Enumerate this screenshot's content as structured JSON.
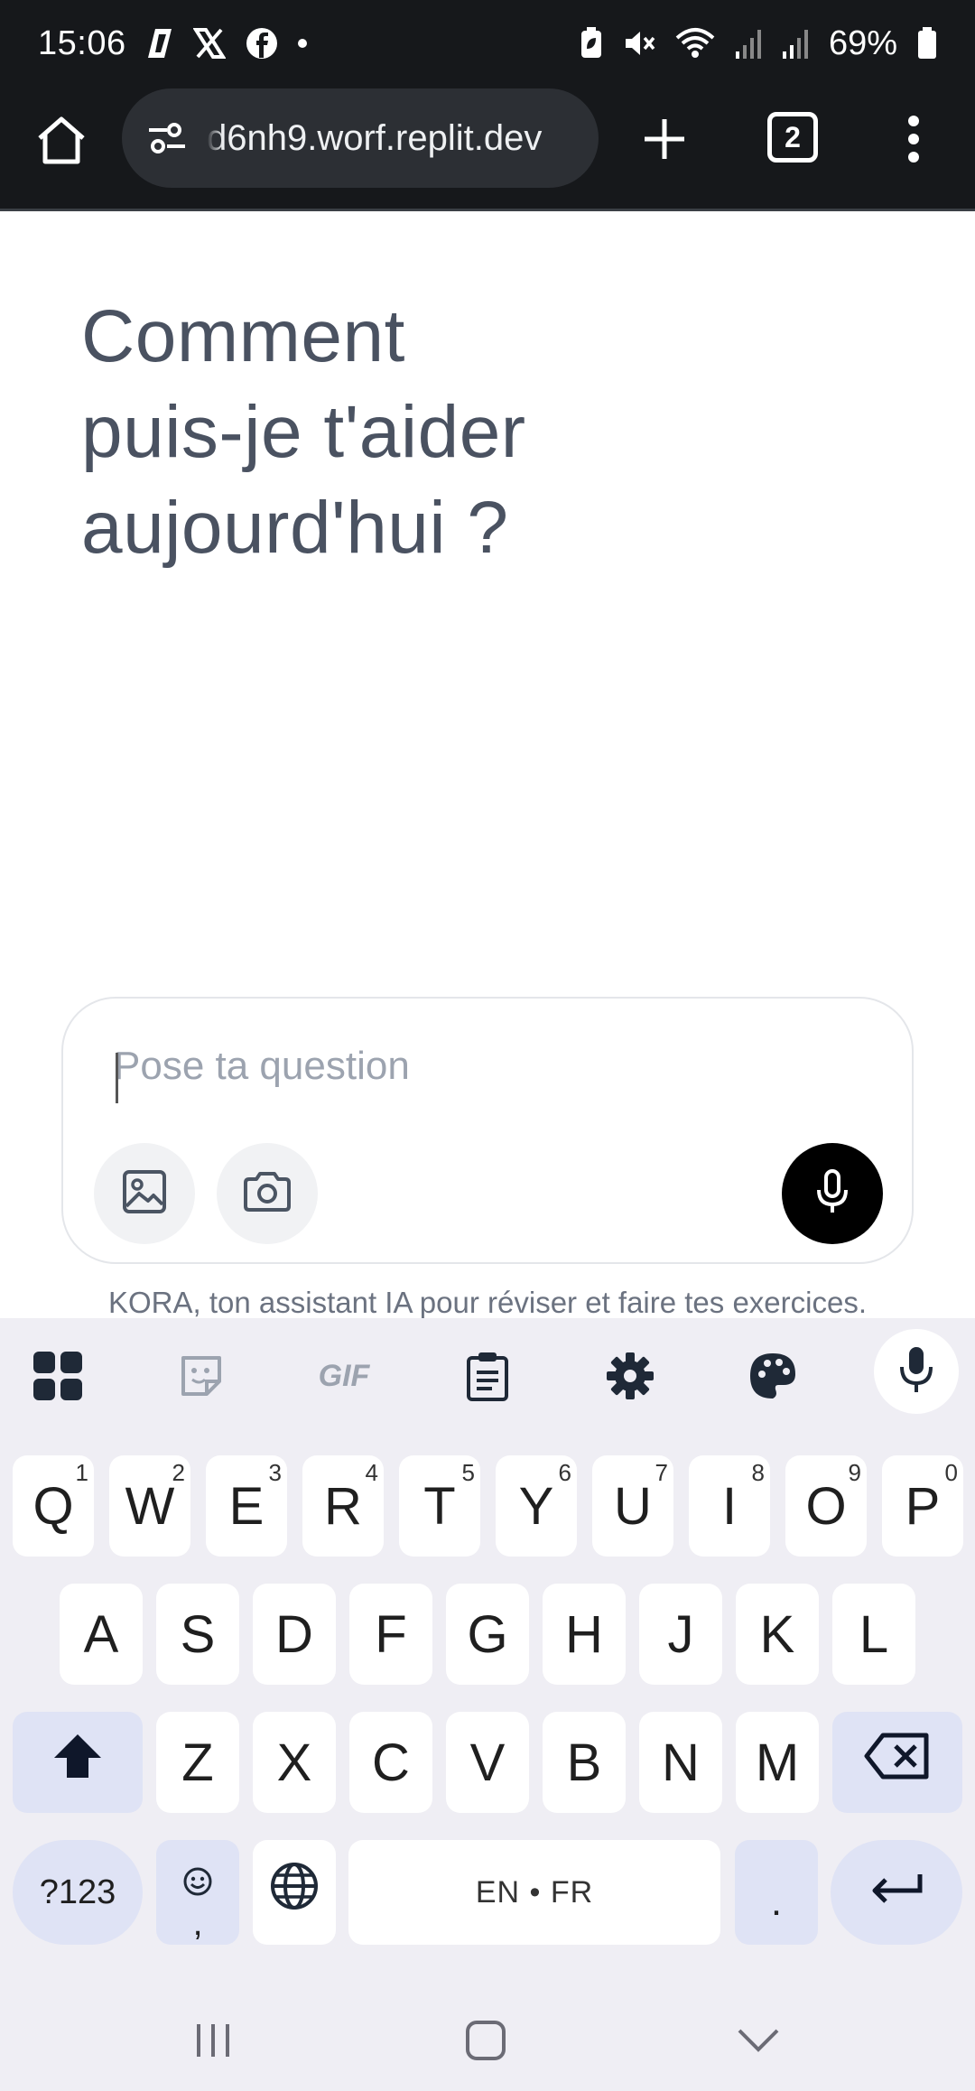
{
  "status_bar": {
    "time": "15:06",
    "battery_percent": "69%",
    "left_icons": [
      "app-slash-icon",
      "x-logo-icon",
      "facebook-icon",
      "dot-icon"
    ],
    "right_icons": [
      "battery-saver-icon",
      "mute-icon",
      "wifi-icon",
      "signal-icon",
      "signal-icon",
      "battery-icon"
    ]
  },
  "browser": {
    "url": "d6nh9.worf.replit.dev",
    "tab_count": "2"
  },
  "page": {
    "headline_lines": [
      "Comment",
      "puis-je t'aider",
      "aujourd'hui ?"
    ],
    "composer": {
      "placeholder": "Pose ta question",
      "value": ""
    },
    "disclaimer": "KORA, ton assistant IA pour réviser et faire tes exercices."
  },
  "keyboard": {
    "toolbar_icons": [
      "apps-grid-icon",
      "sticker-icon",
      "gif-icon",
      "clipboard-icon",
      "settings-icon",
      "palette-icon",
      "microphone-icon"
    ],
    "gif_label": "GIF",
    "row1": [
      {
        "k": "Q",
        "s": "1"
      },
      {
        "k": "W",
        "s": "2"
      },
      {
        "k": "E",
        "s": "3"
      },
      {
        "k": "R",
        "s": "4"
      },
      {
        "k": "T",
        "s": "5"
      },
      {
        "k": "Y",
        "s": "6"
      },
      {
        "k": "U",
        "s": "7"
      },
      {
        "k": "I",
        "s": "8"
      },
      {
        "k": "O",
        "s": "9"
      },
      {
        "k": "P",
        "s": "0"
      }
    ],
    "row2": [
      "A",
      "S",
      "D",
      "F",
      "G",
      "H",
      "J",
      "K",
      "L"
    ],
    "row3": [
      "Z",
      "X",
      "C",
      "V",
      "B",
      "N",
      "M"
    ],
    "symbols_label": "?123",
    "emoji_sub": ",",
    "space_label": "EN • FR",
    "period_label": "."
  },
  "colors": {
    "headline": "#4a5261",
    "status_bar_bg": "#16181b",
    "keyboard_bg": "#efeef4",
    "modifier_key": "#dfe3f5",
    "mic_button": "#000000"
  }
}
